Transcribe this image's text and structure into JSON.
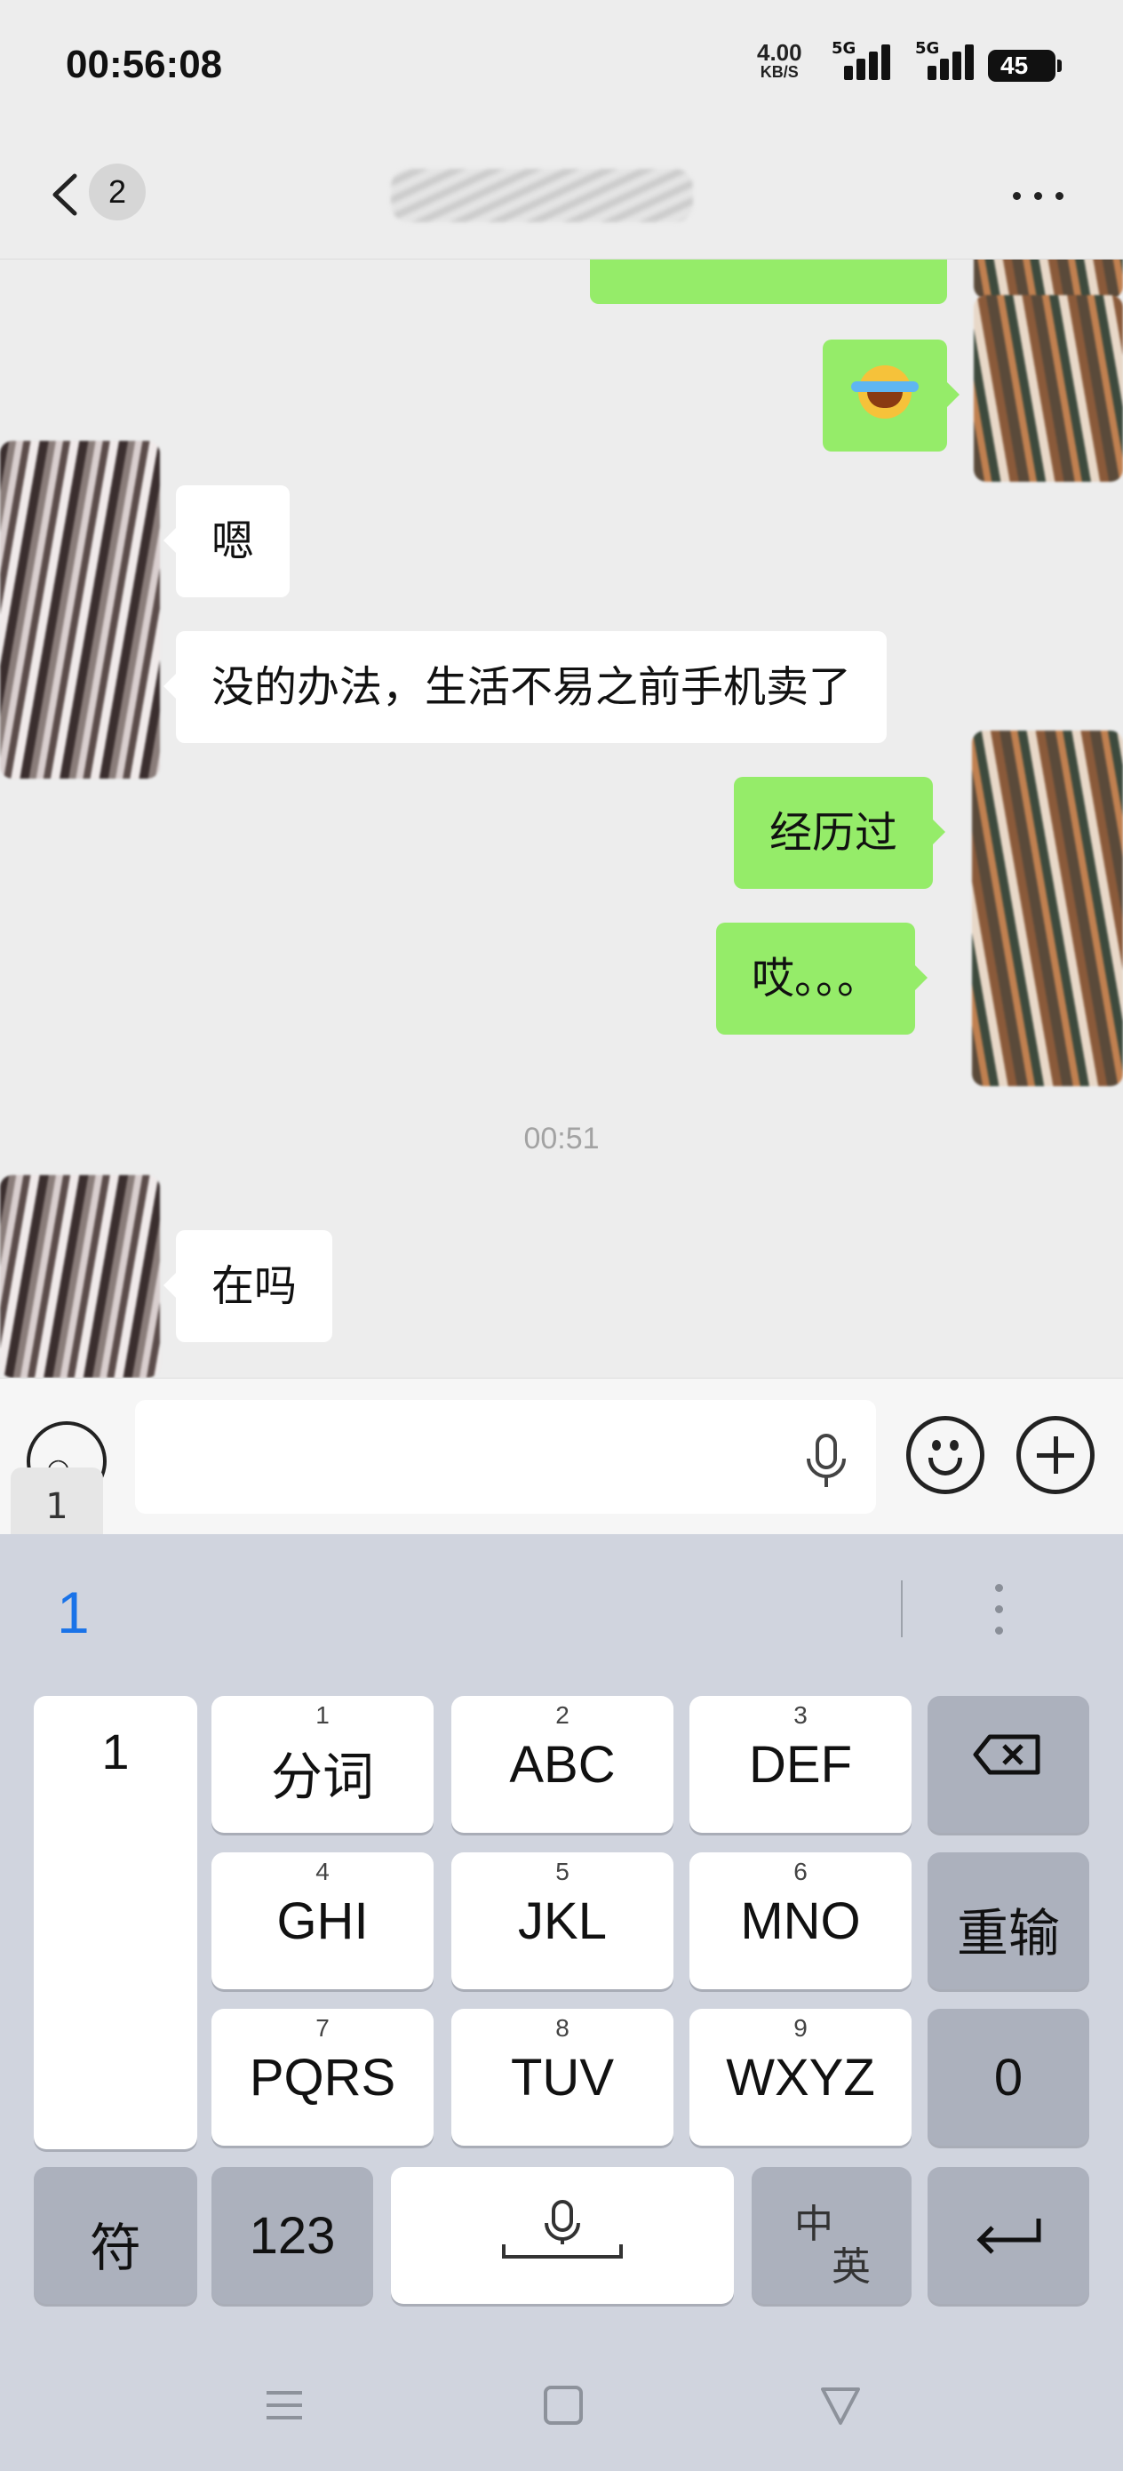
{
  "status_bar": {
    "time": "00:56:08",
    "network_speed": "4.00",
    "network_unit": "KB/S",
    "sim1": "5G",
    "sim2": "5G",
    "battery": "45"
  },
  "nav": {
    "back_count": "2"
  },
  "messages": [
    {
      "side": "in",
      "text": "嗯"
    },
    {
      "side": "in",
      "text": "没的办法，生活不易之前手机卖了"
    },
    {
      "side": "out",
      "text": "经历过"
    },
    {
      "side": "out",
      "text": "哎。。。"
    },
    {
      "side": "in",
      "text": "在吗"
    }
  ],
  "timestamp": "00:51",
  "input_bar": {
    "toggle_label": "1",
    "input_value": ""
  },
  "keyboard": {
    "candidate": "1",
    "side_key": "1",
    "keys": [
      {
        "num": "1",
        "label": "分词"
      },
      {
        "num": "2",
        "label": "ABC"
      },
      {
        "num": "3",
        "label": "DEF"
      },
      {
        "num": "4",
        "label": "GHI"
      },
      {
        "num": "5",
        "label": "JKL"
      },
      {
        "num": "6",
        "label": "MNO"
      },
      {
        "num": "7",
        "label": "PQRS"
      },
      {
        "num": "8",
        "label": "TUV"
      },
      {
        "num": "9",
        "label": "WXYZ"
      }
    ],
    "reinput": "重输",
    "zero": "0",
    "symbols": "符",
    "numbers": "123",
    "lang_top": "中",
    "lang_bottom": "英"
  }
}
